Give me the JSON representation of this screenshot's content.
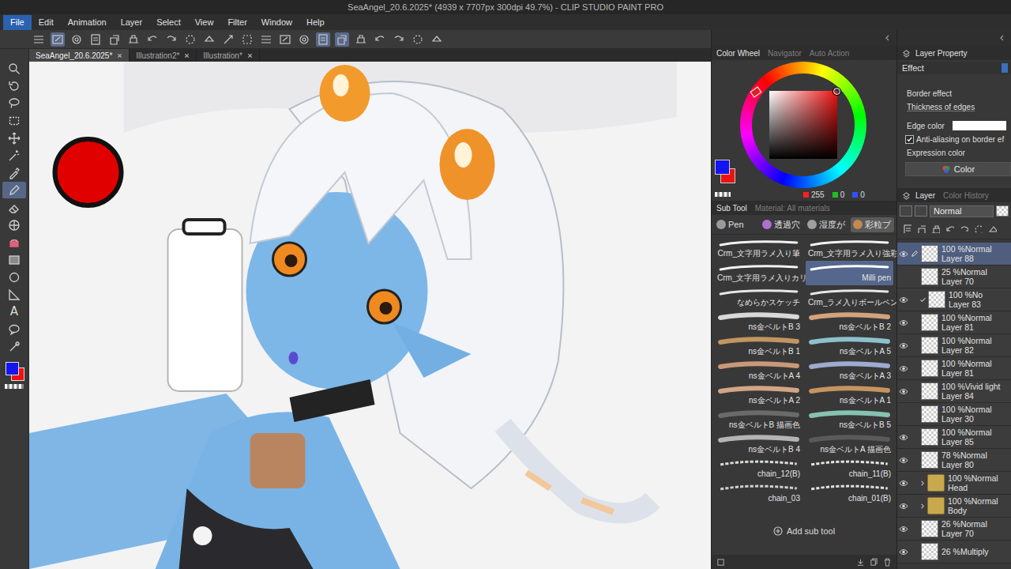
{
  "window": {
    "title": "SeaAngel_20.6.2025* (4939 x 7707px 300dpi 49.7%) - CLIP STUDIO PAINT PRO"
  },
  "menu": [
    {
      "label": "File",
      "selected": true
    },
    {
      "label": "Edit",
      "selected": false
    },
    {
      "label": "Animation",
      "selected": false
    },
    {
      "label": "Layer",
      "selected": false
    },
    {
      "label": "Select",
      "selected": false
    },
    {
      "label": "View",
      "selected": false
    },
    {
      "label": "Filter",
      "selected": false
    },
    {
      "label": "Window",
      "selected": false
    },
    {
      "label": "Help",
      "selected": false
    }
  ],
  "command_bar": [
    {
      "selected": false
    },
    {
      "selected": true
    },
    {
      "selected": false
    },
    {
      "selected": false
    },
    {
      "selected": false
    },
    {
      "selected": false
    },
    {
      "selected": false
    },
    {
      "selected": false
    },
    {
      "selected": false
    },
    {
      "selected": false
    },
    {
      "selected": false
    },
    {
      "selected": false
    },
    {
      "selected": false
    },
    {
      "selected": false
    },
    {
      "selected": false
    },
    {
      "selected": true
    },
    {
      "selected": true
    },
    {
      "selected": false
    },
    {
      "selected": false
    },
    {
      "selected": false
    },
    {
      "selected": false
    },
    {
      "selected": false
    }
  ],
  "canvas_tabs": [
    {
      "label": "SeaAngel_20.6.2025*",
      "selected": true
    },
    {
      "label": "Illustration2*",
      "selected": false
    },
    {
      "label": "Illustration*",
      "selected": false
    }
  ],
  "tools": [
    {
      "kind": "zoom",
      "selected": false
    },
    {
      "kind": "rotate",
      "selected": false
    },
    {
      "kind": "lasso",
      "selected": false
    },
    {
      "kind": "marquee",
      "selected": false
    },
    {
      "kind": "move",
      "selected": false
    },
    {
      "kind": "wand",
      "selected": false
    },
    {
      "kind": "eyedropper",
      "selected": false
    },
    {
      "kind": "pen",
      "selected": true
    },
    {
      "kind": "eraser",
      "selected": false
    },
    {
      "kind": "grid",
      "selected": false
    },
    {
      "kind": "fill",
      "selected": false
    },
    {
      "kind": "gradient",
      "selected": false
    },
    {
      "kind": "figure",
      "selected": false
    },
    {
      "kind": "ruler",
      "selected": false
    },
    {
      "kind": "text",
      "glyph": "A",
      "selected": false
    },
    {
      "kind": "balloon",
      "selected": false
    },
    {
      "kind": "correct",
      "selected": false
    }
  ],
  "colors": {
    "main": "#1414f0",
    "sub": "#ee1111"
  },
  "color_panel": {
    "tabs": [
      {
        "label": "Color Wheel",
        "selected": true
      },
      {
        "label": "Navigator",
        "selected": false
      },
      {
        "label": "Auto Action",
        "selected": false
      }
    ],
    "readout": [
      {
        "value": "255",
        "color": "#ff2020"
      },
      {
        "value": "0",
        "color": "#20c020"
      },
      {
        "value": "0",
        "color": "#3050ff"
      }
    ]
  },
  "sub_tool_panel": {
    "tabs": [
      {
        "label": "Sub Tool",
        "selected": true
      },
      {
        "label": "Material: All materials",
        "selected": false
      }
    ],
    "groups": [
      {
        "label": "Pen",
        "selected": false,
        "color": "#9a9a9a"
      },
      {
        "label": "透過穴",
        "selected": false,
        "color": "#b070d0"
      },
      {
        "label": "湿度が",
        "selected": false,
        "color": "#a0a0a0"
      },
      {
        "label": "彩粒ブ",
        "selected": true,
        "color": "#c08a50"
      }
    ],
    "brushes": [
      {
        "name": "Crm_文字用ラメ入り筆",
        "selected": false,
        "kind": "solid",
        "color": "#f2f2f2"
      },
      {
        "name": "Crm_文字用ラメ入り強彩",
        "selected": false,
        "kind": "solid",
        "color": "#f2f2f2"
      },
      {
        "name": "Crm_文字用ラメ入りカリ",
        "selected": false,
        "kind": "solid",
        "color": "#f2f2f2"
      },
      {
        "name": "Milli pen",
        "selected": true,
        "kind": "solid",
        "color": "#ffffff"
      },
      {
        "name": "なめらかスケッチ",
        "selected": false,
        "kind": "solid",
        "color": "#e6e6e6"
      },
      {
        "name": "Crm_ラメ入りボールペン",
        "selected": false,
        "kind": "solid",
        "color": "#e6e6e6"
      },
      {
        "name": "ns金ベルトB 3",
        "selected": false,
        "kind": "belt",
        "color": "#d8d8dc"
      },
      {
        "name": "ns金ベルトB 2",
        "selected": false,
        "kind": "belt",
        "color": "#d4a27c"
      },
      {
        "name": "ns金ベルトB 1",
        "selected": false,
        "kind": "belt",
        "color": "#c29560"
      },
      {
        "name": "ns金ベルトA 5",
        "selected": false,
        "kind": "belt",
        "color": "#8ec0cc"
      },
      {
        "name": "ns金ベルトA 4",
        "selected": false,
        "kind": "belt",
        "color": "#c89878"
      },
      {
        "name": "ns金ベルトA 3",
        "selected": false,
        "kind": "belt",
        "color": "#9eaad0"
      },
      {
        "name": "ns金ベルトA 2",
        "selected": false,
        "kind": "belt",
        "color": "#d2a684"
      },
      {
        "name": "ns金ベルトA 1",
        "selected": false,
        "kind": "belt",
        "color": "#c6955e"
      },
      {
        "name": "ns金ベルトB 描画色",
        "selected": false,
        "kind": "belt",
        "color": "#6a6a6a"
      },
      {
        "name": "ns金ベルトB 5",
        "selected": false,
        "kind": "belt",
        "color": "#86c2b0"
      },
      {
        "name": "ns金ベルトB 4",
        "selected": false,
        "kind": "belt",
        "color": "#b4b4b4"
      },
      {
        "name": "ns金ベルトA 描画色",
        "selected": false,
        "kind": "belt",
        "color": "#5a5a5a"
      },
      {
        "name": "chain_12(B)",
        "selected": false,
        "kind": "chain",
        "color": "#dcdcdc"
      },
      {
        "name": "chain_11(B)",
        "selected": false,
        "kind": "chain",
        "color": "#e4e4e4"
      },
      {
        "name": "chain_03",
        "selected": false,
        "kind": "chain",
        "color": "#d0d0d0"
      },
      {
        "name": "chain_01(B)",
        "selected": false,
        "kind": "chain",
        "color": "#e0e0e0"
      }
    ],
    "add_button": "Add sub tool"
  },
  "layer_property": {
    "title": "Layer Property",
    "section": "Effect",
    "border_effect": "Border effect",
    "thickness_label": "Thickness of edges",
    "edge_color_label": "Edge color",
    "edge_color": "#ffffff",
    "antialias": {
      "label": "Anti-aliasing on border ef",
      "checked": true
    },
    "expression_color_label": "Expression color",
    "color_button": "Color"
  },
  "layer_panel": {
    "tabs": [
      {
        "label": "Layer",
        "selected": true
      },
      {
        "label": "Color History",
        "selected": false
      }
    ],
    "blend_mode": "Normal",
    "layers": [
      {
        "mode": "100 %Normal",
        "name": "Layer 88",
        "kind": "layer",
        "visible": true,
        "selected": true,
        "clipped": false
      },
      {
        "mode": "25 %Normal",
        "name": "Layer 70",
        "kind": "layer",
        "visible": false,
        "selected": false,
        "clipped": false
      },
      {
        "mode": "100 %No",
        "name": "Layer 83",
        "kind": "layer",
        "visible": true,
        "selected": false,
        "clipped": true
      },
      {
        "mode": "100 %Normal",
        "name": "Layer 81",
        "kind": "layer",
        "visible": true,
        "selected": false,
        "clipped": false
      },
      {
        "mode": "100 %Normal",
        "name": "Layer 82",
        "kind": "layer",
        "visible": true,
        "selected": false,
        "clipped": false
      },
      {
        "mode": "100 %Normal",
        "name": "Layer 81",
        "kind": "layer",
        "visible": true,
        "selected": false,
        "clipped": false
      },
      {
        "mode": "100 %Vivid light",
        "name": "Layer 84",
        "kind": "layer",
        "visible": true,
        "selected": false,
        "clipped": false
      },
      {
        "mode": "100 %Normal",
        "name": "Layer 30",
        "kind": "layer",
        "visible": false,
        "selected": false,
        "clipped": false
      },
      {
        "mode": "100 %Normal",
        "name": "Layer 85",
        "kind": "layer",
        "visible": true,
        "selected": false,
        "clipped": false
      },
      {
        "mode": "78 %Normal",
        "name": "Layer 80",
        "kind": "layer",
        "visible": true,
        "selected": false,
        "clipped": false
      },
      {
        "mode": "100 %Normal",
        "name": "Head",
        "kind": "folder",
        "visible": true,
        "selected": false,
        "clipped": false
      },
      {
        "mode": "100 %Normal",
        "name": "Body",
        "kind": "folder",
        "visible": true,
        "selected": false,
        "clipped": false
      },
      {
        "mode": "26 %Normal",
        "name": "Layer 70",
        "kind": "layer",
        "visible": true,
        "selected": false,
        "clipped": false
      },
      {
        "mode": "26 %Multiply",
        "name": "",
        "kind": "layer",
        "visible": true,
        "selected": false,
        "clipped": false
      }
    ]
  }
}
